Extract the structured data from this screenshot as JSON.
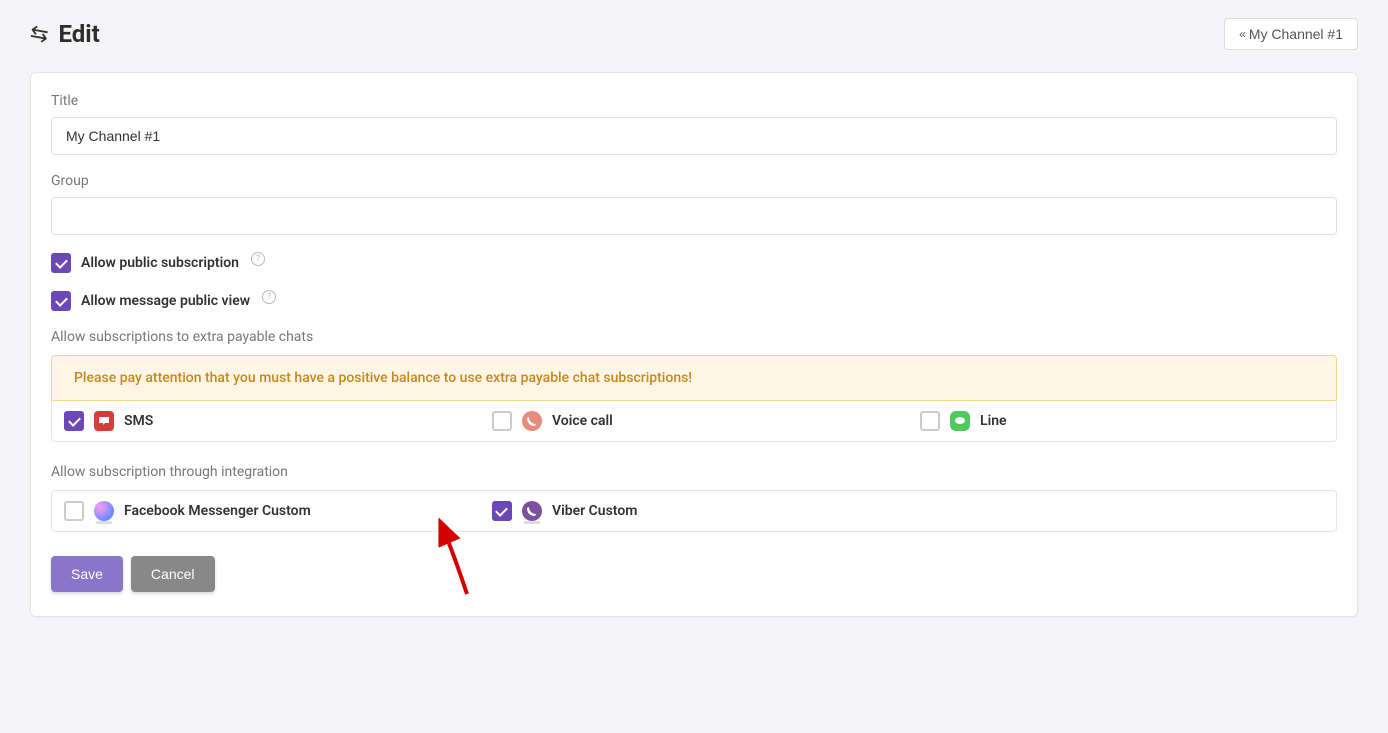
{
  "header": {
    "title": "Edit",
    "breadcrumb_label": "My Channel #1"
  },
  "form": {
    "title_label": "Title",
    "title_value": "My Channel #1",
    "group_label": "Group",
    "group_value": "",
    "allow_public_subscription_label": "Allow public subscription",
    "allow_public_subscription_checked": true,
    "allow_message_public_view_label": "Allow message public view",
    "allow_message_public_view_checked": true,
    "payable_section_label": "Allow subscriptions to extra payable chats",
    "payable_warning": "Please pay attention that you must have a positive balance to use extra payable chat subscriptions!",
    "payable_options": [
      {
        "label": "SMS",
        "checked": true,
        "icon": "sms"
      },
      {
        "label": "Voice call",
        "checked": false,
        "icon": "voice"
      },
      {
        "label": "Line",
        "checked": false,
        "icon": "line"
      }
    ],
    "integration_section_label": "Allow subscription through integration",
    "integration_options": [
      {
        "label": "Facebook Messenger Custom",
        "checked": false,
        "icon": "fb"
      },
      {
        "label": "Viber Custom",
        "checked": true,
        "icon": "viber"
      }
    ]
  },
  "buttons": {
    "save": "Save",
    "cancel": "Cancel"
  }
}
